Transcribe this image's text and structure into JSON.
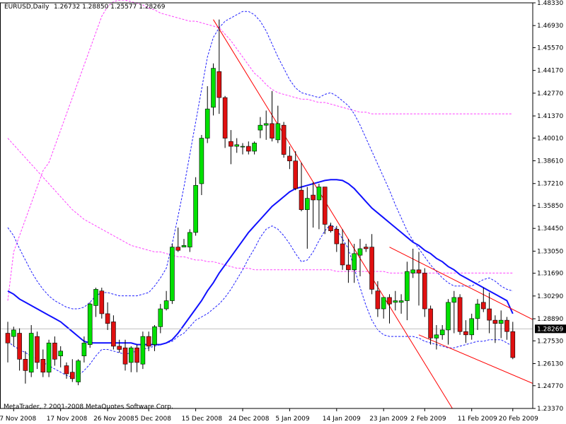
{
  "header": {
    "symbol_label": "EURUSD,Daily",
    "ohlc_values": "1.26732 1.28850 1.25577 1.28269"
  },
  "copyright": "MetaTrader, ? 2001-2008 MetaQuotes Software Corp.",
  "current_price_label": "1.28269",
  "colors": {
    "bull": "#00e000",
    "bear": "#e01010",
    "ma": "#1010ff",
    "bands": "#2020ff",
    "envelope": "#ff40ff",
    "trendline": "#ff0000",
    "current_line": "#c0c0c0"
  },
  "chart_data": {
    "type": "candlestick",
    "symbol": "EURUSD",
    "timeframe": "Daily",
    "ylim": [
      1.2337,
      1.4833
    ],
    "y_ticks": [
      "1.48330",
      "1.46930",
      "1.45570",
      "1.44170",
      "1.42770",
      "1.41370",
      "1.40010",
      "1.38610",
      "1.37210",
      "1.35850",
      "1.34450",
      "1.33050",
      "1.31690",
      "1.30290",
      "1.28890",
      "1.27530",
      "1.26130",
      "1.24770",
      "1.23370"
    ],
    "x_ticks": [
      {
        "label": "7 Nov 2008",
        "index": 1
      },
      {
        "label": "17 Nov 2008",
        "index": 9
      },
      {
        "label": "26 Nov 2008",
        "index": 17
      },
      {
        "label": "5 Dec 2008",
        "index": 24
      },
      {
        "label": "15 Dec 2008",
        "index": 32
      },
      {
        "label": "24 Dec 2008",
        "index": 40
      },
      {
        "label": "5 Jan 2009",
        "index": 48
      },
      {
        "label": "14 Jan 2009",
        "index": 56
      },
      {
        "label": "23 Jan 2009",
        "index": 64
      },
      {
        "label": "2 Feb 2009",
        "index": 71
      },
      {
        "label": "11 Feb 2009",
        "index": 79
      },
      {
        "label": "20 Feb 2009",
        "index": 86
      }
    ],
    "candles": [
      [
        1.28,
        1.287,
        1.262,
        1.274
      ],
      [
        1.278,
        1.284,
        1.272,
        1.282
      ],
      [
        1.28,
        1.283,
        1.257,
        1.264
      ],
      [
        1.264,
        1.269,
        1.249,
        1.257
      ],
      [
        1.256,
        1.285,
        1.253,
        1.28
      ],
      [
        1.278,
        1.281,
        1.258,
        1.262
      ],
      [
        1.264,
        1.27,
        1.253,
        1.256
      ],
      [
        1.256,
        1.276,
        1.253,
        1.274
      ],
      [
        1.274,
        1.278,
        1.26,
        1.264
      ],
      [
        1.266,
        1.272,
        1.259,
        1.269
      ],
      [
        1.26,
        1.262,
        1.252,
        1.255
      ],
      [
        1.256,
        1.264,
        1.25,
        1.252
      ],
      [
        1.25,
        1.264,
        1.248,
        1.263
      ],
      [
        1.266,
        1.278,
        1.262,
        1.274
      ],
      [
        1.273,
        1.299,
        1.271,
        1.298
      ],
      [
        1.297,
        1.308,
        1.29,
        1.307
      ],
      [
        1.306,
        1.308,
        1.289,
        1.292
      ],
      [
        1.292,
        1.299,
        1.282,
        1.286
      ],
      [
        1.287,
        1.291,
        1.27,
        1.272
      ],
      [
        1.272,
        1.276,
        1.268,
        1.27
      ],
      [
        1.271,
        1.276,
        1.257,
        1.261
      ],
      [
        1.262,
        1.272,
        1.256,
        1.271
      ],
      [
        1.271,
        1.273,
        1.256,
        1.262
      ],
      [
        1.261,
        1.281,
        1.258,
        1.278
      ],
      [
        1.278,
        1.281,
        1.269,
        1.272
      ],
      [
        1.273,
        1.285,
        1.269,
        1.284
      ],
      [
        1.284,
        1.298,
        1.28,
        1.295
      ],
      [
        1.295,
        1.306,
        1.294,
        1.3
      ],
      [
        1.3,
        1.335,
        1.298,
        1.333
      ],
      [
        1.333,
        1.345,
        1.33,
        1.331
      ],
      [
        1.333,
        1.338,
        1.333,
        1.334
      ],
      [
        1.333,
        1.344,
        1.33,
        1.342
      ],
      [
        1.342,
        1.376,
        1.34,
        1.371
      ],
      [
        1.372,
        1.402,
        1.365,
        1.4
      ],
      [
        1.4,
        1.432,
        1.397,
        1.418
      ],
      [
        1.419,
        1.446,
        1.414,
        1.443
      ],
      [
        1.441,
        1.473,
        1.415,
        1.425
      ],
      [
        1.425,
        1.426,
        1.394,
        1.4
      ],
      [
        1.398,
        1.405,
        1.384,
        1.395
      ],
      [
        1.395,
        1.4,
        1.391,
        1.396
      ],
      [
        1.395,
        1.397,
        1.39,
        1.395
      ],
      [
        1.395,
        1.398,
        1.39,
        1.392
      ],
      [
        1.392,
        1.398,
        1.39,
        1.397
      ],
      [
        1.405,
        1.413,
        1.4,
        1.408
      ],
      [
        1.408,
        1.417,
        1.399,
        1.409
      ],
      [
        1.409,
        1.429,
        1.398,
        1.4
      ],
      [
        1.399,
        1.42,
        1.397,
        1.409
      ],
      [
        1.408,
        1.41,
        1.388,
        1.39
      ],
      [
        1.389,
        1.395,
        1.381,
        1.386
      ],
      [
        1.386,
        1.392,
        1.368,
        1.369
      ],
      [
        1.368,
        1.385,
        1.355,
        1.356
      ],
      [
        1.356,
        1.37,
        1.332,
        1.363
      ],
      [
        1.365,
        1.373,
        1.345,
        1.362
      ],
      [
        1.362,
        1.372,
        1.344,
        1.37
      ],
      [
        1.37,
        1.37,
        1.341,
        1.347
      ],
      [
        1.346,
        1.348,
        1.342,
        1.343
      ],
      [
        1.344,
        1.346,
        1.33,
        1.335
      ],
      [
        1.335,
        1.344,
        1.319,
        1.322
      ],
      [
        1.322,
        1.338,
        1.311,
        1.319
      ],
      [
        1.319,
        1.335,
        1.311,
        1.329
      ],
      [
        1.328,
        1.338,
        1.315,
        1.332
      ],
      [
        1.333,
        1.335,
        1.33,
        1.332
      ],
      [
        1.333,
        1.341,
        1.304,
        1.307
      ],
      [
        1.306,
        1.312,
        1.29,
        1.295
      ],
      [
        1.295,
        1.3,
        1.289,
        1.302
      ],
      [
        1.302,
        1.304,
        1.286,
        1.298
      ],
      [
        1.299,
        1.306,
        1.294,
        1.3
      ],
      [
        1.299,
        1.304,
        1.292,
        1.3
      ],
      [
        1.3,
        1.324,
        1.288,
        1.318
      ],
      [
        1.317,
        1.332,
        1.314,
        1.319
      ],
      [
        1.319,
        1.33,
        1.297,
        1.317
      ],
      [
        1.317,
        1.32,
        1.29,
        1.295
      ],
      [
        1.295,
        1.297,
        1.273,
        1.277
      ],
      [
        1.277,
        1.285,
        1.27,
        1.279
      ],
      [
        1.279,
        1.285,
        1.276,
        1.282
      ],
      [
        1.282,
        1.301,
        1.273,
        1.299
      ],
      [
        1.299,
        1.306,
        1.28,
        1.302
      ],
      [
        1.302,
        1.304,
        1.279,
        1.281
      ],
      [
        1.281,
        1.288,
        1.274,
        1.279
      ],
      [
        1.279,
        1.292,
        1.276,
        1.289
      ],
      [
        1.289,
        1.301,
        1.282,
        1.298
      ],
      [
        1.299,
        1.308,
        1.293,
        1.295
      ],
      [
        1.295,
        1.305,
        1.28,
        1.288
      ],
      [
        1.288,
        1.291,
        1.274,
        1.286
      ],
      [
        1.286,
        1.294,
        1.277,
        1.288
      ],
      [
        1.288,
        1.29,
        1.276,
        1.281
      ],
      [
        1.281,
        1.287,
        1.264,
        1.265
      ]
    ],
    "ma": [
      1.306,
      1.304,
      1.301,
      1.299,
      1.297,
      1.295,
      1.293,
      1.291,
      1.289,
      1.287,
      1.284,
      1.281,
      1.278,
      1.275,
      1.274,
      1.274,
      1.274,
      1.274,
      1.274,
      1.274,
      1.274,
      1.274,
      1.273,
      1.273,
      1.273,
      1.273,
      1.273,
      1.274,
      1.276,
      1.28,
      1.285,
      1.29,
      1.295,
      1.3,
      1.306,
      1.311,
      1.317,
      1.322,
      1.327,
      1.332,
      1.337,
      1.342,
      1.346,
      1.35,
      1.354,
      1.358,
      1.361,
      1.364,
      1.367,
      1.369,
      1.37,
      1.371,
      1.372,
      1.373,
      1.374,
      1.3745,
      1.3745,
      1.374,
      1.372,
      1.369,
      1.365,
      1.361,
      1.357,
      1.354,
      1.351,
      1.348,
      1.345,
      1.342,
      1.339,
      1.336,
      1.334,
      1.331,
      1.329,
      1.326,
      1.324,
      1.321,
      1.319,
      1.316,
      1.314,
      1.312,
      1.31,
      1.308,
      1.306,
      1.304,
      1.302,
      1.3,
      1.292
    ],
    "upper_band": [
      1.345,
      1.34,
      1.332,
      1.325,
      1.318,
      1.312,
      1.307,
      1.303,
      1.3,
      1.298,
      1.296,
      1.295,
      1.295,
      1.296,
      1.299,
      1.303,
      1.305,
      1.305,
      1.304,
      1.303,
      1.303,
      1.303,
      1.303,
      1.304,
      1.305,
      1.309,
      1.314,
      1.32,
      1.335,
      1.352,
      1.37,
      1.39,
      1.41,
      1.43,
      1.45,
      1.462,
      1.468,
      1.472,
      1.474,
      1.476,
      1.478,
      1.478,
      1.476,
      1.472,
      1.466,
      1.458,
      1.45,
      1.443,
      1.436,
      1.431,
      1.428,
      1.427,
      1.426,
      1.425,
      1.427,
      1.428,
      1.426,
      1.423,
      1.42,
      1.415,
      1.408,
      1.4,
      1.392,
      1.384,
      1.376,
      1.368,
      1.359,
      1.351,
      1.343,
      1.337,
      1.332,
      1.327,
      1.322,
      1.318,
      1.314,
      1.311,
      1.309,
      1.309,
      1.309,
      1.309,
      1.311,
      1.313,
      1.314,
      1.312,
      1.309,
      1.307,
      1.306
    ],
    "lower_band": [
      1.275,
      1.272,
      1.27,
      1.268,
      1.266,
      1.264,
      1.262,
      1.26,
      1.258,
      1.256,
      1.254,
      1.253,
      1.254,
      1.257,
      1.261,
      1.266,
      1.27,
      1.27,
      1.269,
      1.268,
      1.267,
      1.268,
      1.269,
      1.27,
      1.271,
      1.272,
      1.273,
      1.274,
      1.275,
      1.278,
      1.28,
      1.284,
      1.288,
      1.29,
      1.292,
      1.295,
      1.298,
      1.302,
      1.307,
      1.313,
      1.319,
      1.326,
      1.332,
      1.339,
      1.344,
      1.346,
      1.344,
      1.34,
      1.335,
      1.329,
      1.324,
      1.325,
      1.33,
      1.337,
      1.343,
      1.347,
      1.344,
      1.338,
      1.332,
      1.32,
      1.308,
      1.297,
      1.288,
      1.282,
      1.279,
      1.278,
      1.278,
      1.278,
      1.278,
      1.278,
      1.277,
      1.275,
      1.274,
      1.273,
      1.272,
      1.271,
      1.271,
      1.272,
      1.273,
      1.274,
      1.275,
      1.275,
      1.276,
      1.276,
      1.276,
      1.274,
      1.272
    ],
    "envelope_upper": [
      1.3,
      1.33,
      1.34,
      1.35,
      1.36,
      1.37,
      1.38,
      1.385,
      1.395,
      1.405,
      1.415,
      1.425,
      1.435,
      1.445,
      1.455,
      1.465,
      1.475,
      1.481,
      1.484,
      1.485,
      1.485,
      1.484,
      1.483,
      1.482,
      1.48,
      1.479,
      1.477,
      1.476,
      1.475,
      1.474,
      1.473,
      1.472,
      1.472,
      1.471,
      1.47,
      1.469,
      1.468,
      1.464,
      1.46,
      1.455,
      1.45,
      1.445,
      1.44,
      1.437,
      1.433,
      1.43,
      1.428,
      1.427,
      1.426,
      1.425,
      1.424,
      1.424,
      1.423,
      1.422,
      1.422,
      1.421,
      1.42,
      1.419,
      1.418,
      1.417,
      1.416,
      1.416,
      1.415,
      1.415,
      1.415,
      1.415,
      1.415,
      1.415,
      1.415,
      1.415,
      1.415,
      1.415,
      1.415,
      1.415,
      1.415,
      1.415,
      1.415,
      1.415,
      1.415,
      1.415,
      1.415,
      1.415,
      1.415,
      1.415,
      1.415,
      1.415,
      1.415
    ],
    "envelope_lower": [
      1.4,
      1.396,
      1.392,
      1.388,
      1.384,
      1.38,
      1.376,
      1.372,
      1.368,
      1.364,
      1.36,
      1.356,
      1.353,
      1.35,
      1.348,
      1.346,
      1.344,
      1.342,
      1.34,
      1.338,
      1.336,
      1.334,
      1.333,
      1.332,
      1.331,
      1.33,
      1.33,
      1.329,
      1.328,
      1.327,
      1.327,
      1.326,
      1.325,
      1.325,
      1.324,
      1.324,
      1.323,
      1.322,
      1.321,
      1.32,
      1.32,
      1.32,
      1.319,
      1.319,
      1.319,
      1.319,
      1.319,
      1.319,
      1.319,
      1.319,
      1.319,
      1.319,
      1.319,
      1.319,
      1.319,
      1.319,
      1.318,
      1.318,
      1.318,
      1.318,
      1.318,
      1.318,
      1.318,
      1.318,
      1.318,
      1.317,
      1.317,
      1.317,
      1.317,
      1.317,
      1.317,
      1.317,
      1.317,
      1.317,
      1.317,
      1.317,
      1.317,
      1.317,
      1.317,
      1.317,
      1.317,
      1.317,
      1.317,
      1.317,
      1.317,
      1.317,
      1.317
    ],
    "trendlines": [
      {
        "from": [
          35,
          1.473
        ],
        "to": [
          76,
          1.232
        ]
      },
      {
        "from": [
          65,
          1.333
        ],
        "to": [
          94,
          1.28
        ]
      },
      {
        "from": [
          70,
          1.279
        ],
        "to": [
          94,
          1.242
        ]
      }
    ],
    "current_price": 1.28269
  }
}
